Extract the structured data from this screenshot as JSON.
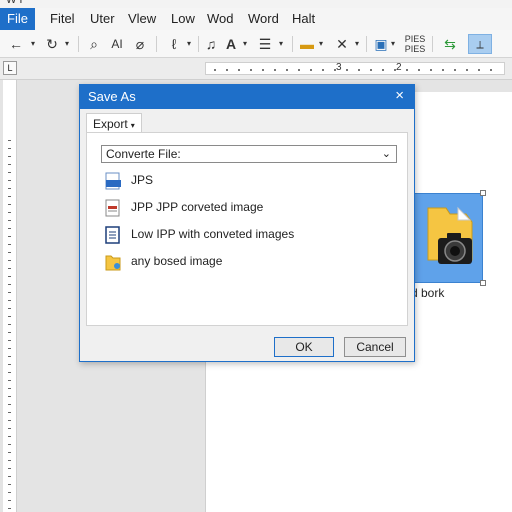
{
  "titlebar": {
    "text": "W P"
  },
  "menubar": {
    "items": [
      "File",
      "Fitel",
      "Uter",
      "Vlew",
      "Low",
      "Wod",
      "Word",
      "Halt"
    ]
  },
  "toolbar": {
    "font_label": "AI",
    "pages_label": "PIES\nPIES"
  },
  "ruler": {
    "numbers": [
      "3",
      "2"
    ]
  },
  "document": {
    "caption_text": "d bork"
  },
  "dialog": {
    "title": "Save As",
    "close_glyph": "×",
    "tab_label": "Export",
    "select_value": "Converte File:",
    "options": [
      {
        "label": "JPS",
        "icon": "image-file-icon"
      },
      {
        "label": "JPP JPP corveted image",
        "icon": "pdf-file-icon"
      },
      {
        "label": "Low IPP with conveted images",
        "icon": "document-file-icon"
      },
      {
        "label": "any bosed image",
        "icon": "folder-image-icon"
      }
    ],
    "ok_label": "OK",
    "cancel_label": "Cancel"
  },
  "colors": {
    "accent": "#1e6fc9",
    "selection": "#5fa2ea",
    "folder": "#f5c542"
  }
}
